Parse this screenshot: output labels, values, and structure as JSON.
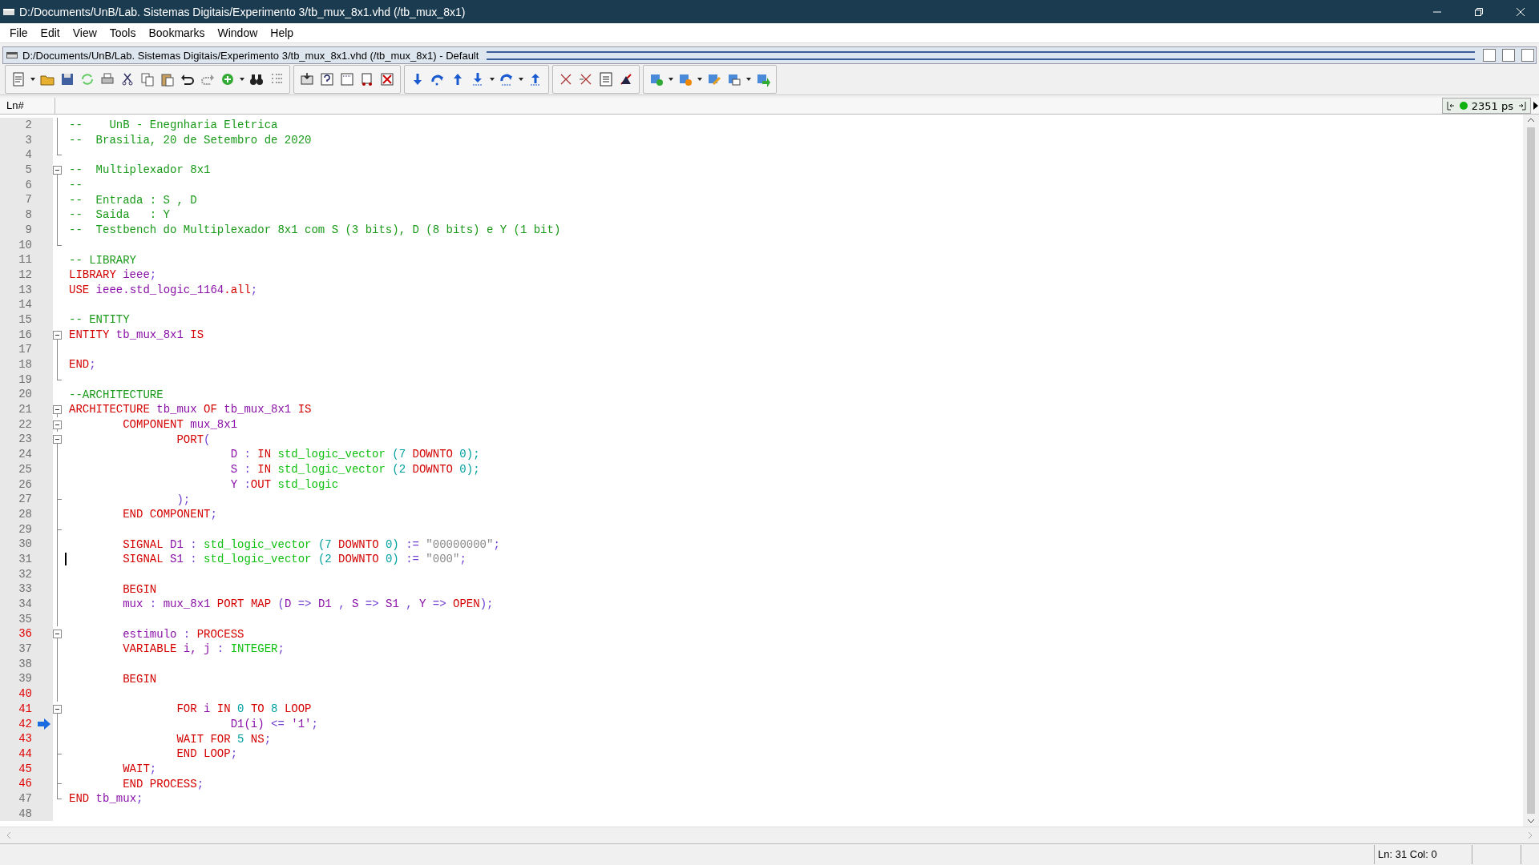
{
  "window": {
    "title": "D:/Documents/UnB/Lab. Sistemas Digitais/Experimento 3/tb_mux_8x1.vhd (/tb_mux_8x1)"
  },
  "menu": [
    "File",
    "Edit",
    "View",
    "Tools",
    "Bookmarks",
    "Window",
    "Help"
  ],
  "document": {
    "title": "D:/Documents/UnB/Lab. Sistemas Digitais/Experimento 3/tb_mux_8x1.vhd (/tb_mux_8x1) - Default"
  },
  "gutter_header": "Ln#",
  "sim_time": {
    "value": "2351 ps"
  },
  "lines": [
    {
      "number": "2",
      "executable": false,
      "fold_start": false,
      "fold_guide": true,
      "fold_end": false,
      "tokens": [
        {
          "kind": "comment",
          "text": "--    UnB - Enegnharia Eletrica"
        }
      ]
    },
    {
      "number": "3",
      "executable": false,
      "fold_start": false,
      "fold_guide": true,
      "fold_end": false,
      "tokens": [
        {
          "kind": "comment",
          "text": "--  Brasilia, 20 de Setembro de 2020"
        }
      ]
    },
    {
      "number": "4",
      "executable": false,
      "fold_start": false,
      "fold_guide": false,
      "fold_end": true
    },
    {
      "number": "5",
      "executable": false,
      "fold_start": true,
      "fold_guide": true,
      "fold_end": false,
      "tokens": [
        {
          "kind": "comment",
          "text": "--  Multiplexador 8x1"
        }
      ]
    },
    {
      "number": "6",
      "executable": false,
      "fold_start": false,
      "fold_guide": true,
      "fold_end": false,
      "tokens": [
        {
          "kind": "comment",
          "text": "--"
        }
      ]
    },
    {
      "number": "7",
      "executable": false,
      "fold_start": false,
      "fold_guide": true,
      "fold_end": false,
      "tokens": [
        {
          "kind": "comment",
          "text": "--  Entrada : S , D"
        }
      ]
    },
    {
      "number": "8",
      "executable": false,
      "fold_start": false,
      "fold_guide": true,
      "fold_end": false,
      "tokens": [
        {
          "kind": "comment",
          "text": "--  Saida   : Y"
        }
      ]
    },
    {
      "number": "9",
      "executable": false,
      "fold_start": false,
      "fold_guide": true,
      "fold_end": false,
      "tokens": [
        {
          "kind": "comment",
          "text": "--  Testbench do Multiplexador 8x1 com S (3 bits), D (8 bits) e Y (1 bit)"
        }
      ]
    },
    {
      "number": "10",
      "executable": false,
      "fold_start": false,
      "fold_guide": false,
      "fold_end": true
    },
    {
      "number": "11",
      "executable": false,
      "fold_start": false,
      "fold_guide": false,
      "fold_end": false,
      "tokens": [
        {
          "kind": "comment",
          "text": "-- LIBRARY"
        }
      ]
    },
    {
      "number": "12",
      "executable": false,
      "fold_start": false,
      "fold_guide": false,
      "fold_end": false,
      "tokens": [
        {
          "kind": "keyword",
          "text": "LIBRARY"
        },
        {
          "kind": "identifier",
          "text": " ieee"
        },
        {
          "kind": "operator",
          "text": ";"
        }
      ]
    },
    {
      "number": "13",
      "executable": false,
      "fold_start": false,
      "fold_guide": false,
      "fold_end": false,
      "tokens": [
        {
          "kind": "keyword",
          "text": "USE"
        },
        {
          "kind": "identifier",
          "text": " ieee.std_logic_1164"
        },
        {
          "kind": "keyword",
          "text": ".all"
        },
        {
          "kind": "operator",
          "text": ";"
        }
      ]
    },
    {
      "number": "14",
      "executable": false,
      "fold_start": false,
      "fold_guide": false,
      "fold_end": false
    },
    {
      "number": "15",
      "executable": false,
      "fold_start": false,
      "fold_guide": false,
      "fold_end": false,
      "tokens": [
        {
          "kind": "comment",
          "text": "-- ENTITY"
        }
      ]
    },
    {
      "number": "16",
      "executable": false,
      "fold_start": true,
      "fold_guide": true,
      "fold_end": false,
      "tokens": [
        {
          "kind": "keyword",
          "text": "ENTITY"
        },
        {
          "kind": "identifier",
          "text": " tb_mux_8x1"
        },
        {
          "kind": "keyword",
          "text": " IS"
        }
      ]
    },
    {
      "number": "17",
      "executable": false,
      "fold_start": false,
      "fold_guide": true,
      "fold_end": false
    },
    {
      "number": "18",
      "executable": false,
      "fold_start": false,
      "fold_guide": true,
      "fold_end": false,
      "tokens": [
        {
          "kind": "keyword",
          "text": "END"
        },
        {
          "kind": "operator",
          "text": ";"
        }
      ]
    },
    {
      "number": "19",
      "executable": false,
      "fold_start": false,
      "fold_guide": false,
      "fold_end": true
    },
    {
      "number": "20",
      "executable": false,
      "fold_start": false,
      "fold_guide": false,
      "fold_end": false,
      "tokens": [
        {
          "kind": "comment",
          "text": "--ARCHITECTURE"
        }
      ]
    },
    {
      "number": "21",
      "executable": false,
      "fold_start": true,
      "fold_guide": true,
      "fold_end": false,
      "tokens": [
        {
          "kind": "keyword",
          "text": "ARCHITECTURE"
        },
        {
          "kind": "identifier",
          "text": " tb_mux"
        },
        {
          "kind": "keyword",
          "text": " OF"
        },
        {
          "kind": "identifier",
          "text": " tb_mux_8x1"
        },
        {
          "kind": "keyword",
          "text": " IS"
        }
      ]
    },
    {
      "number": "22",
      "executable": false,
      "fold_start": true,
      "fold_guide": true,
      "fold_end": false,
      "tokens": [
        {
          "kind": "keyword",
          "text": "\tCOMPONENT"
        },
        {
          "kind": "identifier",
          "text": " mux_8x1"
        }
      ]
    },
    {
      "number": "23",
      "executable": false,
      "fold_start": true,
      "fold_guide": true,
      "fold_end": false,
      "tokens": [
        {
          "kind": "keyword",
          "text": "\t\tPORT"
        },
        {
          "kind": "operator",
          "text": "("
        }
      ]
    },
    {
      "number": "24",
      "executable": false,
      "fold_start": false,
      "fold_guide": true,
      "fold_end": false,
      "tokens": [
        {
          "kind": "identifier",
          "text": "\t\t\tD"
        },
        {
          "kind": "operator",
          "text": " :"
        },
        {
          "kind": "keyword",
          "text": " IN"
        },
        {
          "kind": "type",
          "text": " std_logic_vector"
        },
        {
          "kind": "number",
          "text": " (7"
        },
        {
          "kind": "keyword",
          "text": " DOWNTO"
        },
        {
          "kind": "number",
          "text": " 0);"
        }
      ]
    },
    {
      "number": "25",
      "executable": false,
      "fold_start": false,
      "fold_guide": true,
      "fold_end": false,
      "tokens": [
        {
          "kind": "identifier",
          "text": "\t\t\tS"
        },
        {
          "kind": "operator",
          "text": " :"
        },
        {
          "kind": "keyword",
          "text": " IN"
        },
        {
          "kind": "type",
          "text": " std_logic_vector"
        },
        {
          "kind": "number",
          "text": " (2"
        },
        {
          "kind": "keyword",
          "text": " DOWNTO"
        },
        {
          "kind": "number",
          "text": " 0);"
        }
      ]
    },
    {
      "number": "26",
      "executable": false,
      "fold_start": false,
      "fold_guide": true,
      "fold_end": false,
      "tokens": [
        {
          "kind": "identifier",
          "text": "\t\t\tY"
        },
        {
          "kind": "operator",
          "text": " :"
        },
        {
          "kind": "keyword",
          "text": "OUT"
        },
        {
          "kind": "type",
          "text": " std_logic"
        }
      ]
    },
    {
      "number": "27",
      "executable": false,
      "fold_start": false,
      "fold_guide": true,
      "fold_end": true,
      "tokens": [
        {
          "kind": "operator",
          "text": "\t\t);"
        }
      ]
    },
    {
      "number": "28",
      "executable": false,
      "fold_start": false,
      "fold_guide": true,
      "fold_end": false,
      "tokens": [
        {
          "kind": "keyword",
          "text": "\tEND COMPONENT"
        },
        {
          "kind": "operator",
          "text": ";"
        }
      ]
    },
    {
      "number": "29",
      "executable": false,
      "fold_start": false,
      "fold_guide": true,
      "fold_end": true
    },
    {
      "number": "30",
      "executable": false,
      "fold_start": false,
      "fold_guide": true,
      "fold_end": false,
      "tokens": [
        {
          "kind": "keyword",
          "text": "\tSIGNAL"
        },
        {
          "kind": "identifier",
          "text": " D1"
        },
        {
          "kind": "operator",
          "text": " :"
        },
        {
          "kind": "type",
          "text": " std_logic_vector"
        },
        {
          "kind": "number",
          "text": " (7"
        },
        {
          "kind": "keyword",
          "text": " DOWNTO"
        },
        {
          "kind": "number",
          "text": " 0)"
        },
        {
          "kind": "operator",
          "text": " :="
        },
        {
          "kind": "string",
          "text": " \"00000000\""
        },
        {
          "kind": "operator",
          "text": ";"
        }
      ]
    },
    {
      "number": "31",
      "executable": false,
      "fold_start": false,
      "fold_guide": true,
      "fold_end": false,
      "cursor": true,
      "tokens": [
        {
          "kind": "keyword",
          "text": "\tSIGNAL"
        },
        {
          "kind": "identifier",
          "text": " S1"
        },
        {
          "kind": "operator",
          "text": " :"
        },
        {
          "kind": "type",
          "text": " std_logic_vector"
        },
        {
          "kind": "number",
          "text": " (2"
        },
        {
          "kind": "keyword",
          "text": " DOWNTO"
        },
        {
          "kind": "number",
          "text": " 0)"
        },
        {
          "kind": "operator",
          "text": " :="
        },
        {
          "kind": "string",
          "text": " \"000\""
        },
        {
          "kind": "operator",
          "text": ";"
        }
      ]
    },
    {
      "number": "32",
      "executable": false,
      "fold_start": false,
      "fold_guide": true,
      "fold_end": false
    },
    {
      "number": "33",
      "executable": false,
      "fold_start": false,
      "fold_guide": true,
      "fold_end": false,
      "tokens": [
        {
          "kind": "keyword",
          "text": "\tBEGIN"
        }
      ]
    },
    {
      "number": "34",
      "executable": false,
      "fold_start": false,
      "fold_guide": true,
      "fold_end": false,
      "tokens": [
        {
          "kind": "identifier",
          "text": "\tmux"
        },
        {
          "kind": "operator",
          "text": " :"
        },
        {
          "kind": "identifier",
          "text": " mux_8x1"
        },
        {
          "kind": "keyword",
          "text": " PORT MAP"
        },
        {
          "kind": "operator",
          "text": " ("
        },
        {
          "kind": "identifier",
          "text": "D"
        },
        {
          "kind": "operator",
          "text": " =>"
        },
        {
          "kind": "identifier",
          "text": " D1"
        },
        {
          "kind": "operator",
          "text": " ,"
        },
        {
          "kind": "identifier",
          "text": " S"
        },
        {
          "kind": "operator",
          "text": " =>"
        },
        {
          "kind": "identifier",
          "text": " S1"
        },
        {
          "kind": "operator",
          "text": " ,"
        },
        {
          "kind": "identifier",
          "text": " Y"
        },
        {
          "kind": "operator",
          "text": " =>"
        },
        {
          "kind": "keyword",
          "text": " OPEN"
        },
        {
          "kind": "operator",
          "text": ");"
        }
      ]
    },
    {
      "number": "35",
      "executable": false,
      "fold_start": false,
      "fold_guide": true,
      "fold_end": false
    },
    {
      "number": "36",
      "executable": true,
      "fold_start": true,
      "fold_guide": true,
      "fold_end": false,
      "tokens": [
        {
          "kind": "identifier",
          "text": "\testimulo"
        },
        {
          "kind": "operator",
          "text": " :"
        },
        {
          "kind": "keyword",
          "text": " PROCESS"
        }
      ]
    },
    {
      "number": "37",
      "executable": false,
      "fold_start": false,
      "fold_guide": true,
      "fold_end": false,
      "tokens": [
        {
          "kind": "keyword",
          "text": "\tVARIABLE"
        },
        {
          "kind": "identifier",
          "text": " i, j"
        },
        {
          "kind": "operator",
          "text": " :"
        },
        {
          "kind": "type",
          "text": " INTEGER"
        },
        {
          "kind": "operator",
          "text": ";"
        }
      ]
    },
    {
      "number": "38",
      "executable": false,
      "fold_start": false,
      "fold_guide": true,
      "fold_end": false
    },
    {
      "number": "39",
      "executable": false,
      "fold_start": false,
      "fold_guide": true,
      "fold_end": false,
      "tokens": [
        {
          "kind": "keyword",
          "text": "\tBEGIN"
        }
      ]
    },
    {
      "number": "40",
      "executable": true,
      "fold_start": false,
      "fold_guide": true,
      "fold_end": false
    },
    {
      "number": "41",
      "executable": true,
      "fold_start": true,
      "fold_guide": true,
      "fold_end": false,
      "tokens": [
        {
          "kind": "keyword",
          "text": "\t\tFOR"
        },
        {
          "kind": "identifier",
          "text": " i"
        },
        {
          "kind": "keyword",
          "text": " IN"
        },
        {
          "kind": "number",
          "text": " 0"
        },
        {
          "kind": "keyword",
          "text": " TO"
        },
        {
          "kind": "number",
          "text": " 8"
        },
        {
          "kind": "keyword",
          "text": " LOOP"
        }
      ]
    },
    {
      "number": "42",
      "executable": true,
      "fold_start": false,
      "fold_guide": true,
      "fold_end": false,
      "current": true,
      "tokens": [
        {
          "kind": "identifier",
          "text": "\t\t\tD1(i)"
        },
        {
          "kind": "operator",
          "text": " <="
        },
        {
          "kind": "identifier",
          "text": " '1'"
        },
        {
          "kind": "operator",
          "text": ";"
        }
      ]
    },
    {
      "number": "43",
      "executable": true,
      "fold_start": false,
      "fold_guide": true,
      "fold_end": false,
      "tokens": [
        {
          "kind": "keyword",
          "text": "\t\tWAIT FOR"
        },
        {
          "kind": "number",
          "text": " 5"
        },
        {
          "kind": "keyword",
          "text": " NS"
        },
        {
          "kind": "operator",
          "text": ";"
        }
      ]
    },
    {
      "number": "44",
      "executable": true,
      "fold_start": false,
      "fold_guide": true,
      "fold_end": true,
      "tokens": [
        {
          "kind": "keyword",
          "text": "\t\tEND LOOP"
        },
        {
          "kind": "operator",
          "text": ";"
        }
      ]
    },
    {
      "number": "45",
      "executable": true,
      "fold_start": false,
      "fold_guide": true,
      "fold_end": false,
      "tokens": [
        {
          "kind": "keyword",
          "text": "\tWAIT"
        },
        {
          "kind": "operator",
          "text": ";"
        }
      ]
    },
    {
      "number": "46",
      "executable": true,
      "fold_start": false,
      "fold_guide": true,
      "fold_end": true,
      "tokens": [
        {
          "kind": "keyword",
          "text": "\tEND PROCESS"
        },
        {
          "kind": "operator",
          "text": ";"
        }
      ]
    },
    {
      "number": "47",
      "executable": false,
      "fold_start": false,
      "fold_guide": false,
      "fold_end": true,
      "tokens": [
        {
          "kind": "keyword",
          "text": "END"
        },
        {
          "kind": "identifier",
          "text": " tb_mux"
        },
        {
          "kind": "operator",
          "text": ";"
        }
      ]
    },
    {
      "number": "48",
      "executable": false,
      "fold_start": false,
      "fold_guide": false,
      "fold_end": false
    }
  ],
  "status_bar": {
    "position": "Ln:  31 Col: 0"
  }
}
